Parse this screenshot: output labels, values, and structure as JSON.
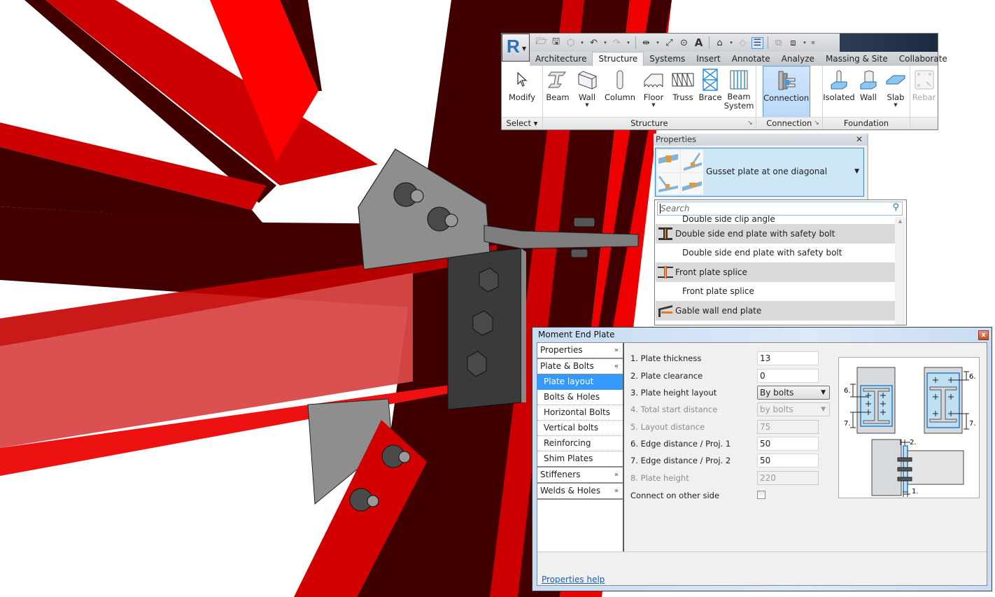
{
  "ribbon": {
    "app_button": {
      "letter": "R"
    },
    "qat_icons": [
      "open-icon",
      "save-icon",
      "sync-icon",
      "undo-icon",
      "redo-icon",
      "measure-icon",
      "dimension-icon",
      "tag-icon",
      "text-icon",
      "3d-view-icon",
      "section-icon",
      "thin-lines-icon",
      "close-hidden-icon",
      "switch-windows-icon",
      "customize-icon"
    ],
    "tabs": [
      {
        "label": "Architecture",
        "active": false
      },
      {
        "label": "Structure",
        "active": true
      },
      {
        "label": "Systems",
        "active": false
      },
      {
        "label": "Insert",
        "active": false
      },
      {
        "label": "Annotate",
        "active": false
      },
      {
        "label": "Analyze",
        "active": false
      },
      {
        "label": "Massing & Site",
        "active": false
      },
      {
        "label": "Collaborate",
        "active": false
      }
    ],
    "panels": {
      "select": {
        "label": "Select",
        "tools": [
          {
            "label": "Modify"
          }
        ]
      },
      "structure": {
        "label": "Structure",
        "tools": [
          {
            "label": "Beam"
          },
          {
            "label": "Wall"
          },
          {
            "label": "Column"
          },
          {
            "label": "Floor"
          },
          {
            "label": "Truss"
          },
          {
            "label": "Brace"
          },
          {
            "label": "Beam System"
          }
        ]
      },
      "connection": {
        "label": "Connection",
        "tools": [
          {
            "label": "Connection"
          }
        ]
      },
      "foundation": {
        "label": "Foundation",
        "tools": [
          {
            "label": "Isolated"
          },
          {
            "label": "Wall"
          },
          {
            "label": "Slab"
          }
        ]
      },
      "reinforcement": {
        "tools": [
          {
            "label": "Rebar"
          }
        ]
      }
    }
  },
  "properties": {
    "title": "Properties",
    "close": "✕",
    "type_selector": {
      "value": "Gusset plate at one diagonal"
    },
    "search": {
      "placeholder": "Search"
    },
    "list": [
      {
        "label": "Double side clip angle",
        "kind": "child"
      },
      {
        "label": "Double side end plate with safety bolt",
        "kind": "group",
        "icon": "end-plate-safety-bolt-icon"
      },
      {
        "label": "Double side end plate with safety bolt",
        "kind": "child"
      },
      {
        "label": "Front plate splice",
        "kind": "group",
        "icon": "front-plate-splice-icon"
      },
      {
        "label": "Front plate splice",
        "kind": "child"
      },
      {
        "label": "Gable wall end plate",
        "kind": "group",
        "icon": "gable-wall-end-plate-icon"
      }
    ]
  },
  "dialog": {
    "title": "Moment End Plate",
    "close": "x",
    "nav": {
      "sections": [
        {
          "label": "Properties",
          "chevron": "»",
          "expanded": false
        },
        {
          "label": "Plate & Bolts",
          "chevron": "«",
          "expanded": true,
          "items": [
            "Plate layout",
            "Bolts & Holes",
            "Horizontal Bolts",
            "Vertical bolts",
            "Reinforcing",
            "Shim Plates"
          ],
          "selected": "Plate layout"
        },
        {
          "label": "Stiffeners",
          "chevron": "»",
          "expanded": false
        },
        {
          "label": "Welds & Holes",
          "chevron": "»",
          "expanded": false
        }
      ]
    },
    "fields": [
      {
        "label": "1. Plate thickness",
        "value": "13",
        "type": "input",
        "enabled": true
      },
      {
        "label": "2. Plate clearance",
        "value": "0",
        "type": "input",
        "enabled": true
      },
      {
        "label": "3. Plate height layout",
        "value": "By bolts",
        "type": "select",
        "enabled": true
      },
      {
        "label": "4. Total start distance",
        "value": "by bolts",
        "type": "select",
        "enabled": false
      },
      {
        "label": "5. Layout distance",
        "value": "75",
        "type": "input",
        "enabled": false
      },
      {
        "label": "6. Edge distance / Proj. 1",
        "value": "50",
        "type": "input",
        "enabled": true
      },
      {
        "label": "7. Edge distance / Proj. 2",
        "value": "50",
        "type": "input",
        "enabled": true
      },
      {
        "label": "8. Plate height",
        "value": "220",
        "type": "input",
        "enabled": false
      },
      {
        "label": "Connect on other side",
        "value": false,
        "type": "checkbox",
        "enabled": true
      }
    ],
    "diagram_labels": {
      "l6a": "6.",
      "l7a": "7.",
      "l6b": "6.",
      "l7b": "7.",
      "l2": "2.",
      "l1": "1."
    },
    "help_link": "Properties help"
  },
  "colors": {
    "steel_red": "#d10000",
    "steel_dark": "#400000",
    "plate_gray": "#8e8e8e",
    "accent_blue": "#3399ff"
  }
}
